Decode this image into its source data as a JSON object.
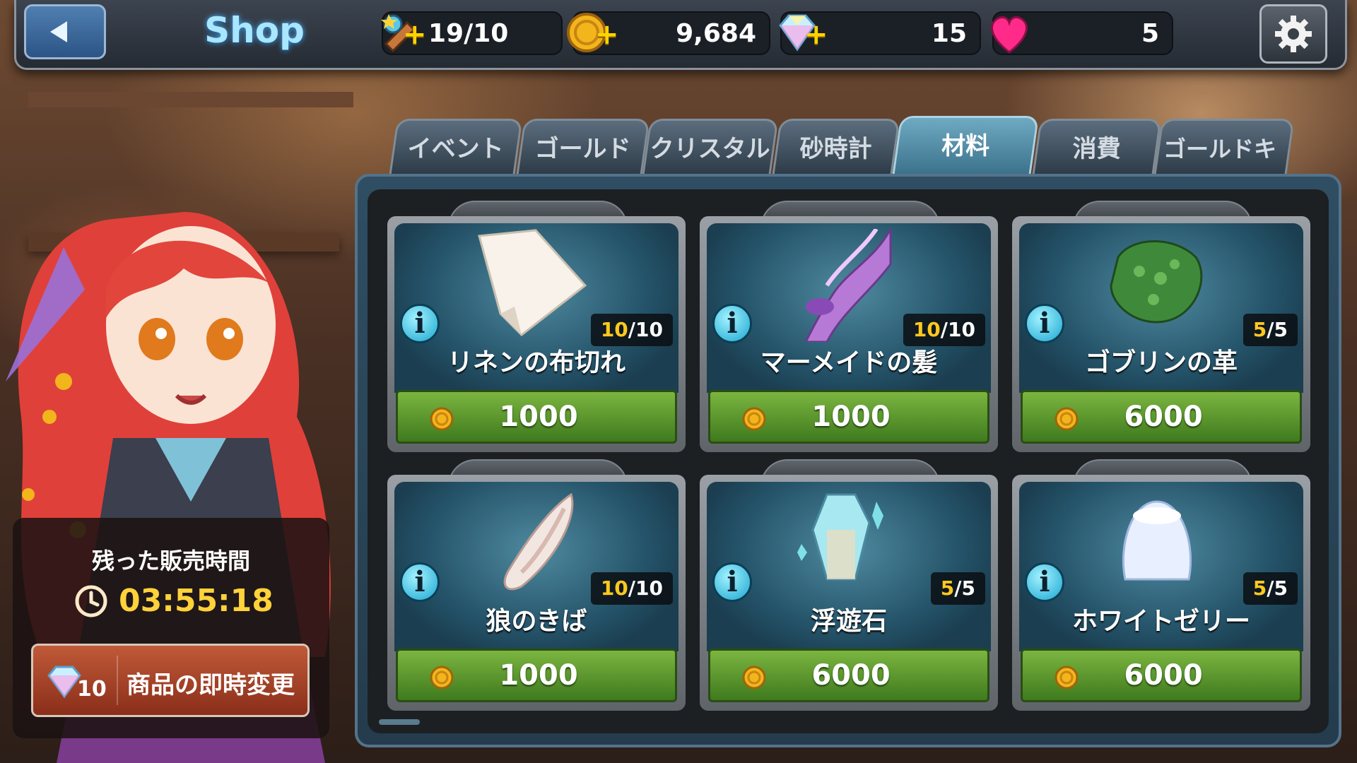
{
  "header": {
    "title": "Shop",
    "stamina": "19/10",
    "gold": "9,684",
    "crystals": "15",
    "hearts": "5"
  },
  "tabs": [
    {
      "label": "イベント",
      "active": false
    },
    {
      "label": "ゴールド",
      "active": false
    },
    {
      "label": "クリスタル",
      "active": false
    },
    {
      "label": "砂時計",
      "active": false
    },
    {
      "label": "材料",
      "active": true
    },
    {
      "label": "消費",
      "active": false
    },
    {
      "label": "ゴールドキー",
      "active": false
    }
  ],
  "items": [
    {
      "name": "リネンの布切れ",
      "stock_current": "10",
      "stock_sep": "/",
      "stock_max": "10",
      "price": "1000",
      "icon": "linen-cloth-icon"
    },
    {
      "name": "マーメイドの髪",
      "stock_current": "10",
      "stock_sep": "/",
      "stock_max": "10",
      "price": "1000",
      "icon": "mermaid-hair-icon"
    },
    {
      "name": "ゴブリンの革",
      "stock_current": "5",
      "stock_sep": "/",
      "stock_max": "5",
      "price": "6000",
      "icon": "goblin-leather-icon"
    },
    {
      "name": "狼のきば",
      "stock_current": "10",
      "stock_sep": "/",
      "stock_max": "10",
      "price": "1000",
      "icon": "wolf-fang-icon"
    },
    {
      "name": "浮遊石",
      "stock_current": "5",
      "stock_sep": "/",
      "stock_max": "5",
      "price": "6000",
      "icon": "floating-stone-icon"
    },
    {
      "name": "ホワイトゼリー",
      "stock_current": "5",
      "stock_sep": "/",
      "stock_max": "5",
      "price": "6000",
      "icon": "white-jelly-icon"
    }
  ],
  "timer": {
    "label": "残った販売時間",
    "value": "03:55:18"
  },
  "change_button": {
    "cost": "10",
    "label": "商品の即時変更"
  },
  "colors": {
    "accent_gold": "#ffc81f",
    "price_green": "#5a9a2e",
    "active_tab": "#4f8da8",
    "change_button": "#a8442a"
  }
}
